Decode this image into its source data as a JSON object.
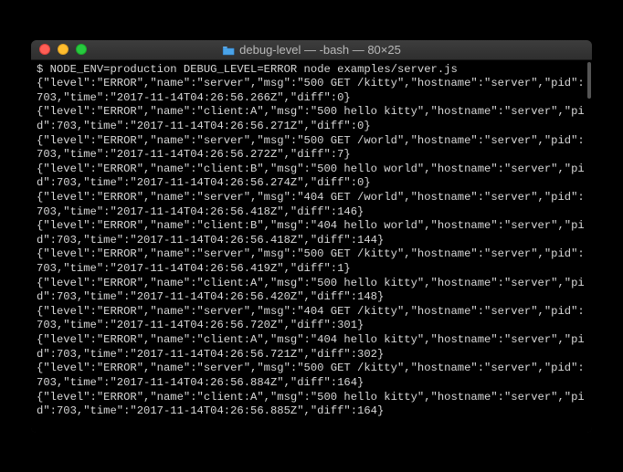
{
  "titlebar": {
    "title": "debug-level — -bash — 80×25"
  },
  "terminal": {
    "prompt": "$ ",
    "command": "NODE_ENV=production DEBUG_LEVEL=ERROR node examples/server.js",
    "scroll_indicator_right": "]",
    "logs": [
      "{\"level\":\"ERROR\",\"name\":\"server\",\"msg\":\"500 GET /kitty\",\"hostname\":\"server\",\"pid\":703,\"time\":\"2017-11-14T04:26:56.266Z\",\"diff\":0}",
      "{\"level\":\"ERROR\",\"name\":\"client:A\",\"msg\":\"500 hello kitty\",\"hostname\":\"server\",\"pid\":703,\"time\":\"2017-11-14T04:26:56.271Z\",\"diff\":0}",
      "{\"level\":\"ERROR\",\"name\":\"server\",\"msg\":\"500 GET /world\",\"hostname\":\"server\",\"pid\":703,\"time\":\"2017-11-14T04:26:56.272Z\",\"diff\":7}",
      "{\"level\":\"ERROR\",\"name\":\"client:B\",\"msg\":\"500 hello world\",\"hostname\":\"server\",\"pid\":703,\"time\":\"2017-11-14T04:26:56.274Z\",\"diff\":0}",
      "{\"level\":\"ERROR\",\"name\":\"server\",\"msg\":\"404 GET /world\",\"hostname\":\"server\",\"pid\":703,\"time\":\"2017-11-14T04:26:56.418Z\",\"diff\":146}",
      "{\"level\":\"ERROR\",\"name\":\"client:B\",\"msg\":\"404 hello world\",\"hostname\":\"server\",\"pid\":703,\"time\":\"2017-11-14T04:26:56.418Z\",\"diff\":144}",
      "{\"level\":\"ERROR\",\"name\":\"server\",\"msg\":\"500 GET /kitty\",\"hostname\":\"server\",\"pid\":703,\"time\":\"2017-11-14T04:26:56.419Z\",\"diff\":1}",
      "{\"level\":\"ERROR\",\"name\":\"client:A\",\"msg\":\"500 hello kitty\",\"hostname\":\"server\",\"pid\":703,\"time\":\"2017-11-14T04:26:56.420Z\",\"diff\":148}",
      "{\"level\":\"ERROR\",\"name\":\"server\",\"msg\":\"404 GET /kitty\",\"hostname\":\"server\",\"pid\":703,\"time\":\"2017-11-14T04:26:56.720Z\",\"diff\":301}",
      "{\"level\":\"ERROR\",\"name\":\"client:A\",\"msg\":\"404 hello kitty\",\"hostname\":\"server\",\"pid\":703,\"time\":\"2017-11-14T04:26:56.721Z\",\"diff\":302}",
      "{\"level\":\"ERROR\",\"name\":\"server\",\"msg\":\"500 GET /kitty\",\"hostname\":\"server\",\"pid\":703,\"time\":\"2017-11-14T04:26:56.884Z\",\"diff\":164}",
      "{\"level\":\"ERROR\",\"name\":\"client:A\",\"msg\":\"500 hello kitty\",\"hostname\":\"server\",\"pid\":703,\"time\":\"2017-11-14T04:26:56.885Z\",\"diff\":164}"
    ]
  }
}
